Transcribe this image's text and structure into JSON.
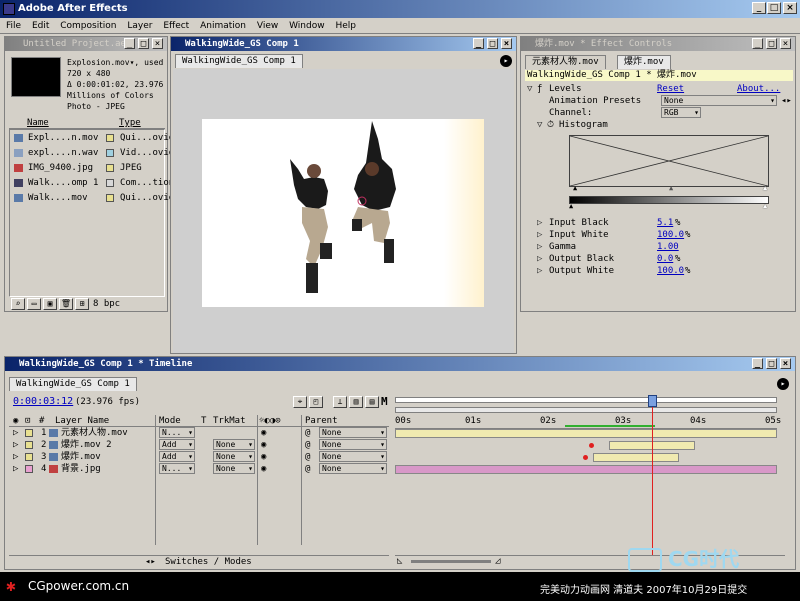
{
  "app": {
    "title": "Adobe After Effects",
    "menu": [
      "File",
      "Edit",
      "Composition",
      "Layer",
      "Effect",
      "Animation",
      "View",
      "Window",
      "Help"
    ],
    "win_buttons": [
      "_",
      "□",
      "×"
    ]
  },
  "project": {
    "title": "Untitled Project.aep *",
    "info": [
      "Explosion.mov▾, used",
      "720 x 480",
      "Δ 0:00:01:02, 23.976",
      "Millions of Colors",
      "Photo - JPEG"
    ],
    "columns": [
      "Name",
      "Type"
    ],
    "items": [
      {
        "name": "Expl....n.mov",
        "type": "Qui...ovie",
        "color": "#e8e090"
      },
      {
        "name": "expl....n.wav",
        "type": "Vid...ovie",
        "color": "#a0d0e0"
      },
      {
        "name": "IMG_9400.jpg",
        "type": "JPEG",
        "color": "#e8e090"
      },
      {
        "name": "Walk....omp 1",
        "type": "Com...tion",
        "color": "#d8d8d8"
      },
      {
        "name": "Walk....mov",
        "type": "Qui...ovie",
        "color": "#e8e090"
      }
    ],
    "bpc": "8 bpc"
  },
  "comp": {
    "title": "WalkingWide_GS Comp 1",
    "tab": "WalkingWide_GS Comp 1"
  },
  "effects": {
    "title": "爆炸.mov * Effect Controls",
    "tabs": [
      "元素材人物.mov",
      "爆炸.mov"
    ],
    "subtitle": "WalkingWide_GS Comp 1 * 爆炸.mov",
    "levels_label": "Levels",
    "reset": "Reset",
    "about": "About...",
    "presets_label": "Animation Presets",
    "presets_value": "None",
    "channel_label": "Channel:",
    "channel_value": "RGB",
    "histogram_label": "Histogram",
    "params": [
      {
        "label": "Input Black",
        "value": "5.1",
        "unit": "%"
      },
      {
        "label": "Input White",
        "value": "100.0",
        "unit": "%"
      },
      {
        "label": "Gamma",
        "value": "1.00",
        "unit": ""
      },
      {
        "label": "Output Black",
        "value": "0.0",
        "unit": "%"
      },
      {
        "label": "Output White",
        "value": "100.0",
        "unit": "%"
      }
    ]
  },
  "timeline": {
    "title": "WalkingWide_GS Comp 1 * Timeline",
    "tab": "WalkingWide_GS Comp 1",
    "timecode": "0:00:03:12",
    "fps": "(23.976 fps)",
    "columns": [
      "#",
      "Layer Name",
      "Mode",
      "T",
      "TrkMat",
      "Parent"
    ],
    "ruler": [
      "00s",
      "01s",
      "02s",
      "03s",
      "04s",
      "05s"
    ],
    "layers": [
      {
        "num": "1",
        "name": "元素材人物.mov",
        "mode": "N...",
        "trkmat": "",
        "parent": "None",
        "color": "#e8e090"
      },
      {
        "num": "2",
        "name": "爆炸.mov 2",
        "mode": "Add",
        "trkmat": "None",
        "parent": "None",
        "color": "#e8e090"
      },
      {
        "num": "3",
        "name": "爆炸.mov",
        "mode": "Add",
        "trkmat": "None",
        "parent": "None",
        "color": "#e8e090"
      },
      {
        "num": "4",
        "name": "背景.jpg",
        "mode": "N...",
        "trkmat": "None",
        "parent": "None",
        "color": "#e8a0d0"
      }
    ],
    "switches_label": "Switches / Modes"
  },
  "watermark": {
    "left": "CGpower.com.cn",
    "right": "完美动力动画网 清道夫 2007年10月29日提交",
    "logo": "CG时代"
  }
}
